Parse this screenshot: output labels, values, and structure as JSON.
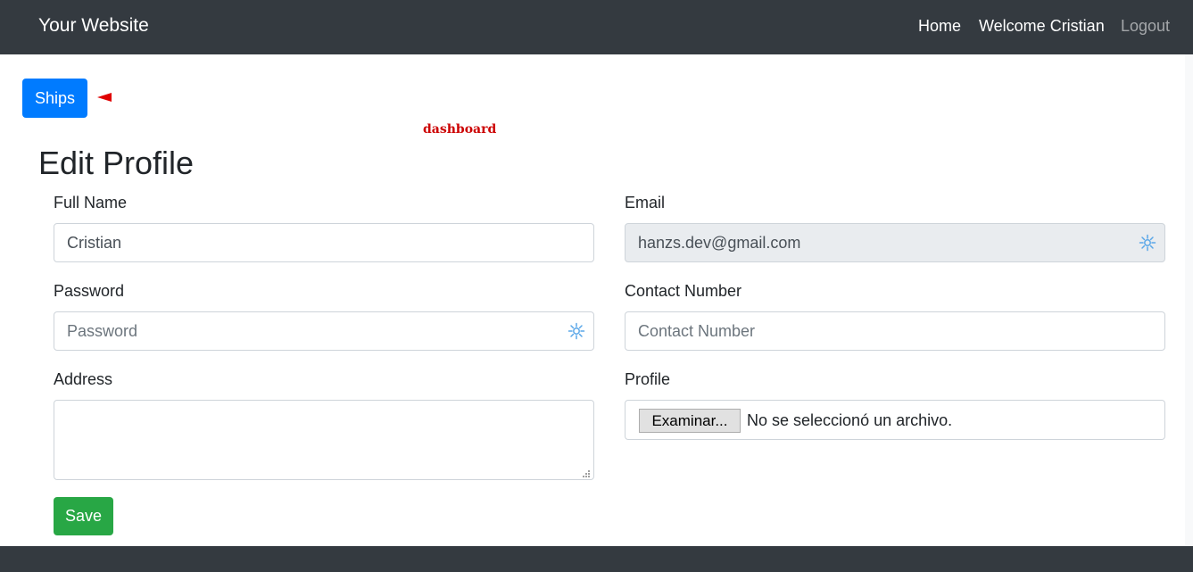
{
  "navbar": {
    "brand": "Your Website",
    "links": {
      "home": "Home",
      "welcome": "Welcome Cristian",
      "logout": "Logout"
    }
  },
  "ships_button": "Ships",
  "dashboard_label": "dashboard",
  "page_title": "Edit Profile",
  "form": {
    "full_name": {
      "label": "Full Name",
      "value": "Cristian"
    },
    "email": {
      "label": "Email",
      "value": "hanzs.dev@gmail.com"
    },
    "password": {
      "label": "Password",
      "placeholder": "Password"
    },
    "contact_number": {
      "label": "Contact Number",
      "placeholder": "Contact Number"
    },
    "address": {
      "label": "Address",
      "value": ""
    },
    "profile": {
      "label": "Profile",
      "button": "Examinar...",
      "status": "No se seleccionó un archivo."
    },
    "save_button": "Save"
  },
  "icons": {
    "field_icon": "password-manager-icon",
    "marker": "red-arrow-marker"
  },
  "colors": {
    "navbar_bg": "#343a40",
    "primary": "#007bff",
    "success": "#28a745",
    "annotation": "#cc0000",
    "readonly_bg": "#e9ecef"
  }
}
